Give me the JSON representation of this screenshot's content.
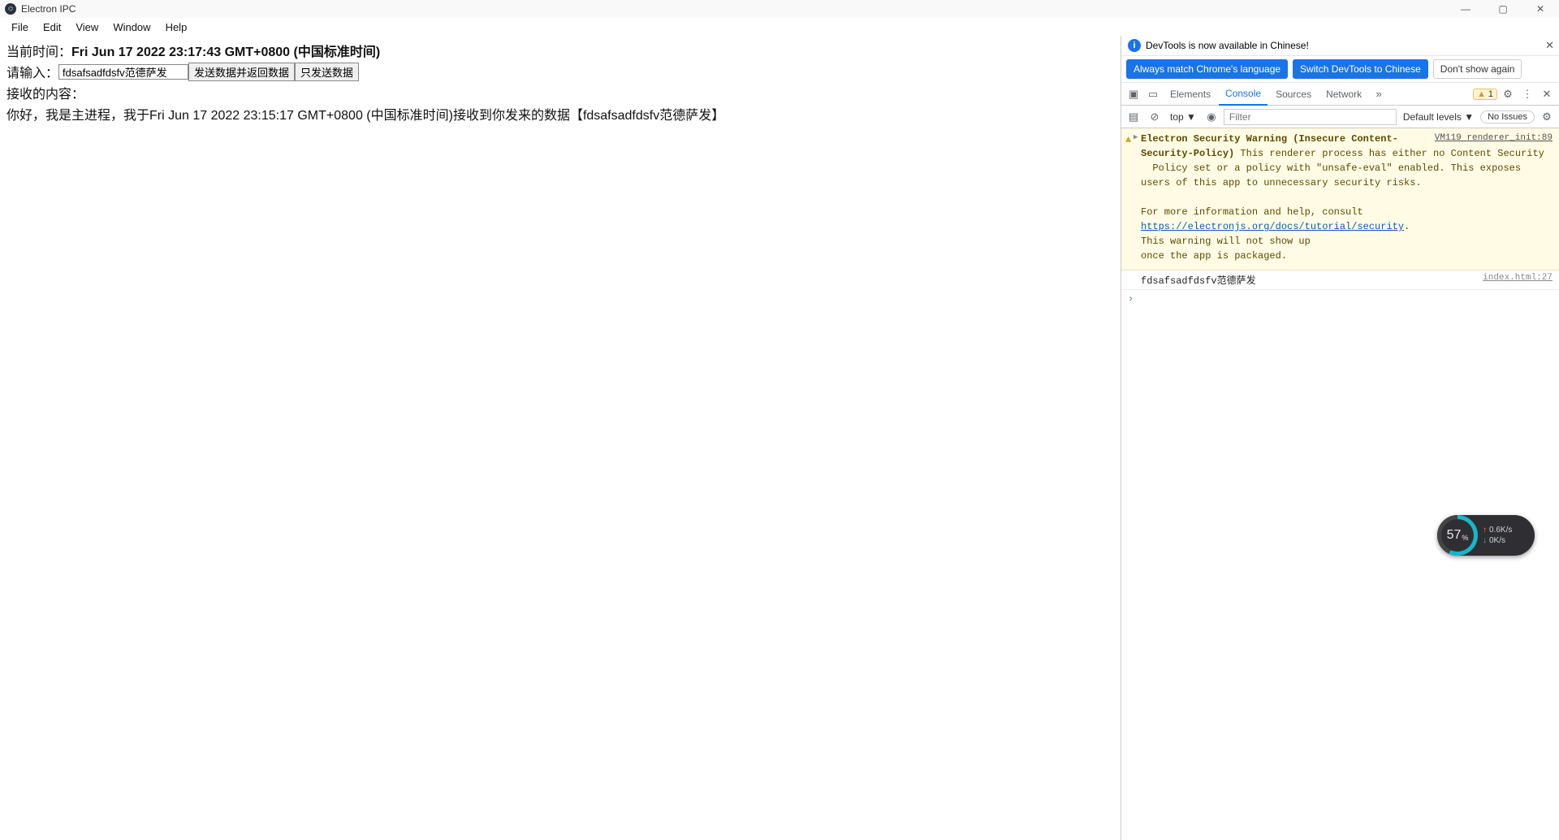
{
  "window": {
    "title": "Electron IPC",
    "controls": {
      "min": "—",
      "max": "▢",
      "close": "✕"
    }
  },
  "menu": {
    "items": [
      "File",
      "Edit",
      "View",
      "Window",
      "Help"
    ]
  },
  "page": {
    "time_label": "当前时间：",
    "time_value": "Fri Jun 17 2022 23:17:43 GMT+0800 (中国标准时间)",
    "input_label": "请输入：",
    "input_value": "fdsafsadfdsfv范德萨发",
    "btn_send_return": "发送数据并返回数据",
    "btn_send_only": "只发送数据",
    "recv_label": "接收的内容：",
    "recv_body": "你好，我是主进程，我于Fri Jun 17 2022 23:15:17 GMT+0800 (中国标准时间)接收到你发来的数据【fdsafsadfdsfv范德萨发】"
  },
  "devtools": {
    "info_text": "DevTools is now available in Chinese!",
    "lang": {
      "always": "Always match Chrome's language",
      "switch": "Switch DevTools to Chinese",
      "dont": "Don't show again"
    },
    "tabs": {
      "elements": "Elements",
      "console": "Console",
      "sources": "Sources",
      "network": "Network",
      "more": "»"
    },
    "warn_count": "1",
    "subbar": {
      "context": "top ▼",
      "filter_placeholder": "Filter",
      "levels": "Default levels ▼",
      "issues": "No Issues"
    },
    "warning": {
      "source": "VM119 renderer_init:89",
      "title": "Electron Security Warning (Insecure Content-Security-Policy)",
      "body1": "This renderer process has either no Content Security",
      "body2": "Policy set or a policy with \"unsafe-eval\" enabled. This exposes users of this app to unnecessary security risks.",
      "more": "For more information and help, consult",
      "link": "https://electronjs.org/docs/tutorial/security",
      "tail": ".",
      "body3": "This warning will not show up",
      "body4": "once the app is packaged."
    },
    "log": {
      "text": "fdsafsadfdsfv范德萨发",
      "source": "index.html:27"
    }
  },
  "gauge": {
    "value": "57",
    "pct": "%",
    "up": "0.6K/s",
    "down": "0K/s"
  }
}
